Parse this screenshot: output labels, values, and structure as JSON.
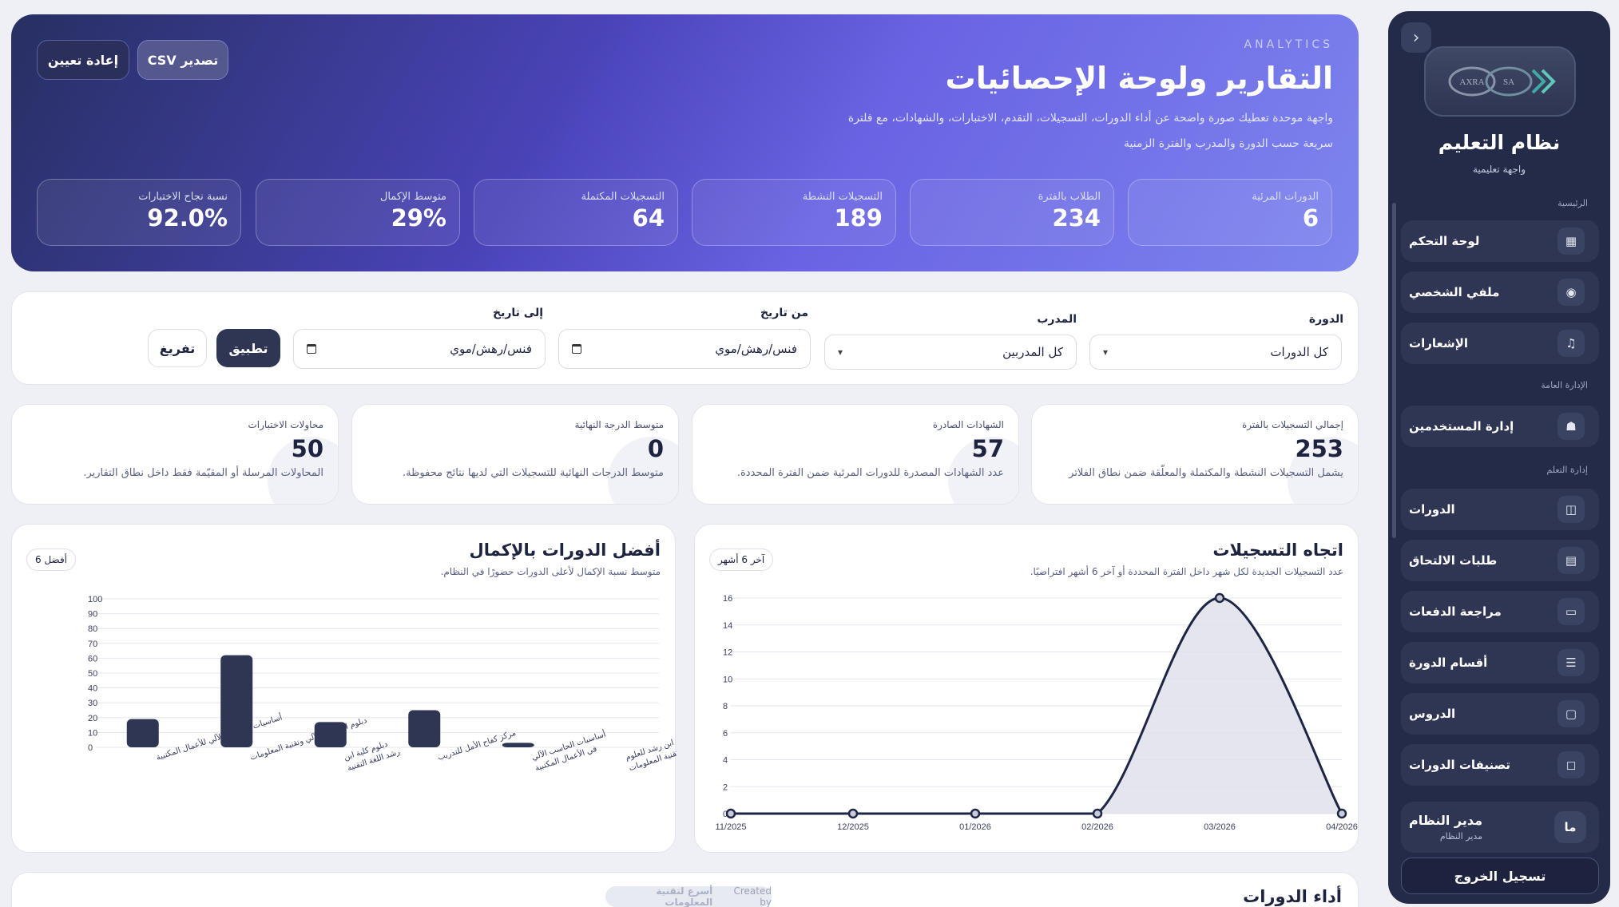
{
  "sidebar": {
    "title": "نظام التعليم",
    "subtitle": "واجهة تعليمية",
    "logo_text": [
      "AXRA",
      "SA"
    ],
    "sections": {
      "main": "الرئيسية",
      "admin": "الإدارة العامة",
      "learning": "إدارة التعلم"
    },
    "items": [
      {
        "label": "لوحة التحكم",
        "icon": "grid-icon"
      },
      {
        "label": "ملفي الشخصي",
        "icon": "user-circle-icon"
      },
      {
        "label": "الإشعارات",
        "icon": "bell-icon"
      },
      {
        "label": "إدارة المستخدمين",
        "icon": "users-icon"
      },
      {
        "label": "الدورات",
        "icon": "book-icon"
      },
      {
        "label": "طلبات الالتحاق",
        "icon": "document-icon"
      },
      {
        "label": "مراجعة الدفعات",
        "icon": "card-icon"
      },
      {
        "label": "أقسام الدورة",
        "icon": "list-icon"
      },
      {
        "label": "الدروس",
        "icon": "folder-icon"
      },
      {
        "label": "تصنيفات الدورات",
        "icon": "file-icon"
      }
    ],
    "user": {
      "avatar": "ما",
      "name": "مدير النظام",
      "role": "مدير النظام"
    },
    "logout_label": "تسجيل الخروج"
  },
  "hero": {
    "eyebrow": "ANALYTICS",
    "title": "التقارير ولوحة الإحصائيات",
    "description_line1": "واجهة موحدة تعطيك صورة واضحة عن أداء الدورات، التسجيلات، التقدم، الاختبارات، والشهادات، مع فلترة",
    "description_line2": "سريعة حسب الدورة والمدرب والفترة الزمنية",
    "reset_label": "إعادة تعيين",
    "export_label": "تصدير CSV",
    "stats": [
      {
        "label": "الدورات المرئية",
        "value": "6"
      },
      {
        "label": "الطلاب بالفترة",
        "value": "234"
      },
      {
        "label": "التسجيلات النشطة",
        "value": "189"
      },
      {
        "label": "التسجيلات المكتملة",
        "value": "64"
      },
      {
        "label": "متوسط الإكمال",
        "value": "29%"
      },
      {
        "label": "نسبة نجاح الاختبارات",
        "value": "92.0%"
      }
    ]
  },
  "filters": {
    "course_label": "الدورة",
    "course_value": "كل الدورات",
    "trainer_label": "المدرب",
    "trainer_value": "كل المدربين",
    "from_label": "من تاريخ",
    "from_value": "فنس/رهش/موي",
    "to_label": "إلى تاريخ",
    "to_value": "فنس/رهش/موي",
    "apply_label": "تطبيق",
    "clear_label": "تفريغ"
  },
  "metrics": [
    {
      "label": "إجمالي التسجيلات بالفترة",
      "value": "253",
      "desc": "يشمل التسجيلات النشطة والمكتملة والمعلّقة ضمن نطاق الفلاتر"
    },
    {
      "label": "الشهادات الصادرة",
      "value": "57",
      "desc": "عدد الشهادات المصدرة للدورات المرئية ضمن الفترة المحددة."
    },
    {
      "label": "متوسط الدرجة النهائية",
      "value": "0",
      "desc": "متوسط الدرجات النهائية للتسجيلات التي لديها نتائج محفوظة."
    },
    {
      "label": "محاولات الاختبارات",
      "value": "50",
      "desc": "المحاولات المرسلة أو المقيّمة فقط داخل نطاق التقارير."
    }
  ],
  "trend_panel": {
    "title": "اتجاه التسجيلات",
    "subtitle": "عدد التسجيلات الجديدة لكل شهر داخل الفترة المحددة أو آخر 6 أشهر افتراضيًا.",
    "badge": "آخر 6 أشهر"
  },
  "courses_panel": {
    "title": "أفضل الدورات بالإكمال",
    "subtitle": "متوسط نسبة الإكمال لأعلى الدورات حضورًا في النظام.",
    "badge": "أفضل 6"
  },
  "bottom": {
    "title": "أداء الدورات"
  },
  "credit": {
    "prefix": "Created by",
    "brand": "أسرع لتقنية المعلومات"
  },
  "colors": {
    "accent": "#2f3654",
    "hero_start": "#272f62",
    "hero_end": "#7d85ee",
    "line": "#1f2545",
    "bar": "#2f3654"
  },
  "chart_data": [
    {
      "type": "area",
      "x": [
        "11/2025",
        "12/2025",
        "01/2026",
        "02/2026",
        "03/2026",
        "04/2026"
      ],
      "values": [
        0,
        0,
        0,
        0,
        16,
        0
      ],
      "yticks": [
        0,
        2,
        4,
        6,
        8,
        10,
        12,
        14,
        16
      ],
      "ylim": [
        0,
        16
      ],
      "grid": true
    },
    {
      "type": "bar",
      "categories": [
        "أساسيات الحاسب الآلي للأعمال المكتبية",
        "دبلوم الحاسب الآلي وتقنية المعلومات",
        "دبلوم كلية ابن رشد اللغة التقنية",
        "مركز كفاح الأمل للتدريب",
        "أساسيات الحاسب الآلي في الأعمال المكتبية",
        "دبلوم كلية ابن رشد للعلوم الإدارية الحاسب الآلي وتقنية المعلومات"
      ],
      "values": [
        19,
        62,
        17,
        25,
        3,
        0
      ],
      "yticks": [
        0,
        10,
        20,
        30,
        40,
        50,
        60,
        70,
        80,
        90,
        100
      ],
      "ylim": [
        0,
        100
      ],
      "grid": true
    }
  ]
}
